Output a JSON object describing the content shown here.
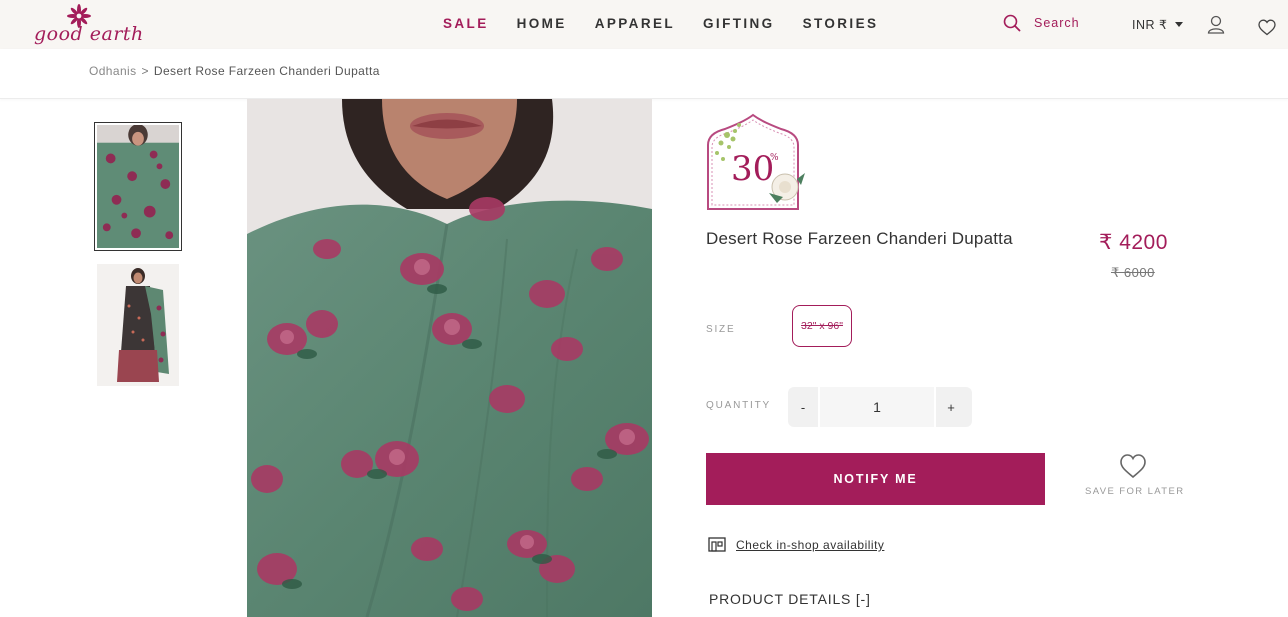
{
  "header": {
    "logo_text": "good earth",
    "nav": [
      "SALE",
      "HOME",
      "APPAREL",
      "GIFTING",
      "STORIES"
    ],
    "search_label": "Search",
    "currency": "INR ₹",
    "icons": [
      "search-icon",
      "user-icon",
      "heart-icon"
    ],
    "accent_color": "#a31d5a"
  },
  "breadcrumb": {
    "parent": "Odhanis",
    "separator": ">",
    "current": "Desert Rose Farzeen Chanderi Dupatta"
  },
  "product": {
    "offer_value": "30",
    "offer_unit": "%",
    "title": "Desert Rose Farzeen Chanderi Dupatta",
    "price": "₹ 4200",
    "original_price": "₹ 6000",
    "size_label": "SIZE",
    "size_option": "32\" x 96\"",
    "quantity_label": "QUANTITY",
    "quantity_minus": "-",
    "quantity_value": "1",
    "quantity_plus": "+",
    "notify_button": "NOTIFY ME",
    "save_for_later": "SAVE FOR LATER",
    "check_availability": "Check in-shop availability",
    "details_heading": "PRODUCT DETAILS [-]"
  }
}
